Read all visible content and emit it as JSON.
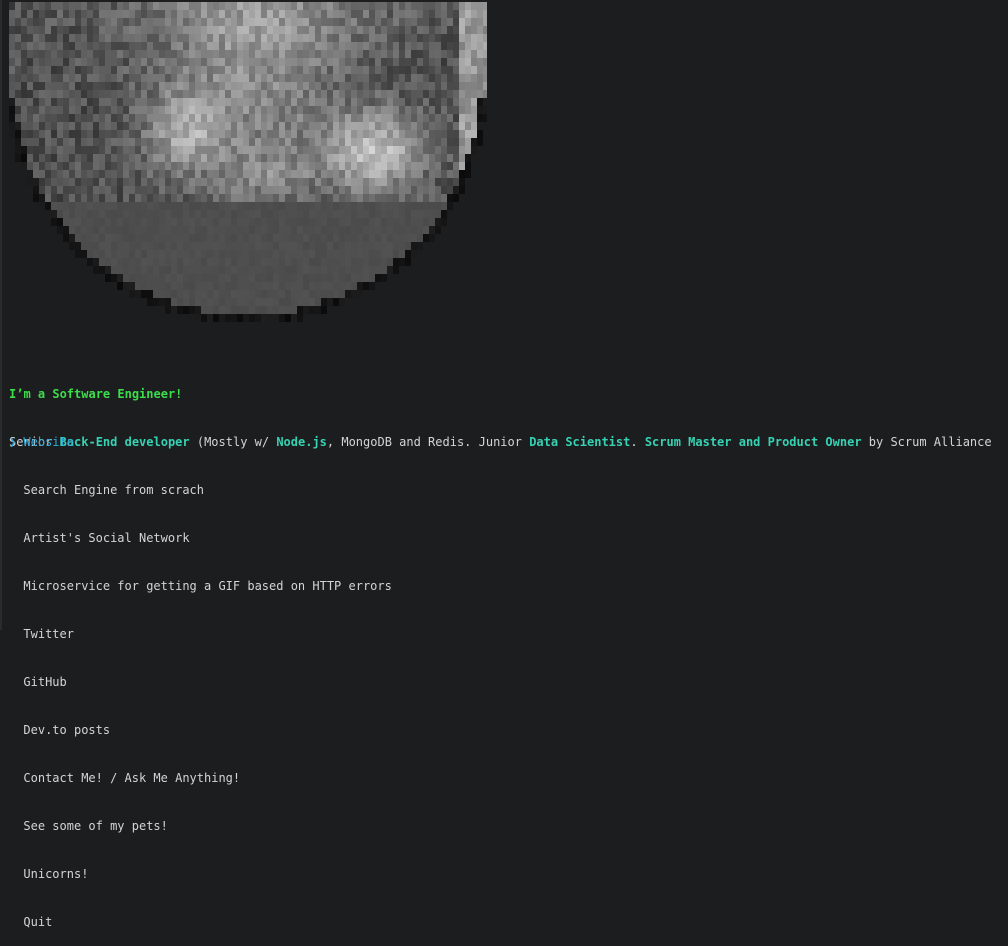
{
  "profile": {
    "headline": "I’m a Software Engineer!",
    "description": {
      "t1": "Senior ",
      "b1": "Back-End developer",
      "t2": " (Mostly w/ ",
      "b2": "Node.js",
      "t3": ", MongoDB and Redis. Junior ",
      "b3": "Data Scientist",
      "t4": ". ",
      "b4": "Scrum Master and Product Owner",
      "t5": " by Scrum Alliance"
    }
  },
  "menu": {
    "pointer": "❯",
    "selected_index": 0,
    "items": [
      "Website",
      "Search Engine from scrach",
      "Artist's Social Network",
      "Microservice for getting a GIF based on HTTP errors",
      "Twitter",
      "GitHub",
      "Dev.to posts",
      "Contact Me! / Ask Me Anything!",
      "See some of my pets!",
      "Unicorns!",
      "Quit"
    ]
  },
  "colors": {
    "background": "#1c1d1f",
    "text": "#d4d4d4",
    "headline": "#3ddc4b",
    "accent": "#36d2b3",
    "selection": "#2fa8d8"
  },
  "icons": {
    "portrait": "pixelated-portrait-image",
    "pointer": "chevron-right-icon"
  }
}
